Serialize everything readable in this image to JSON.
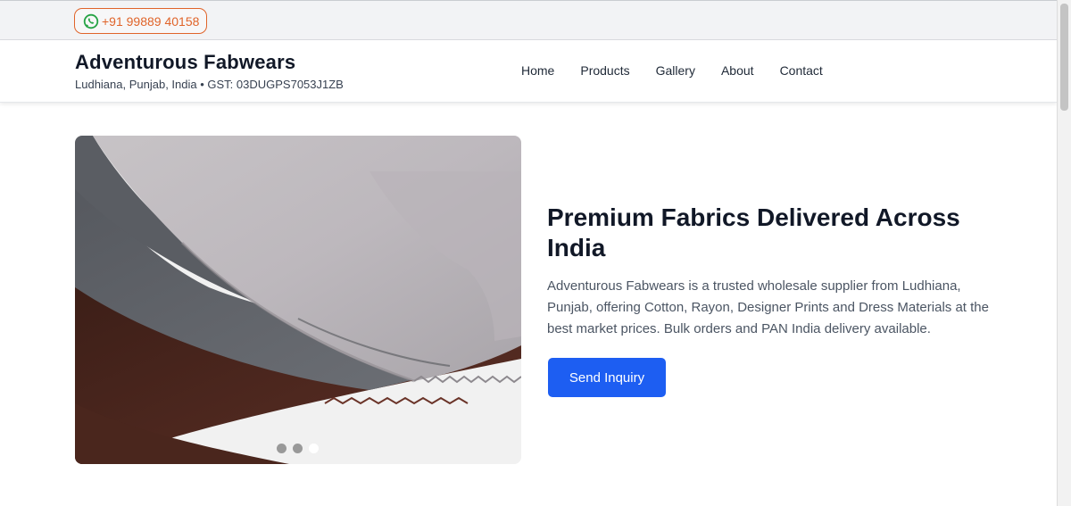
{
  "topbar": {
    "whatsapp_number": "+91 99889 40158",
    "whatsapp_icon": "whatsapp-icon",
    "accent_color": "#e0642a"
  },
  "header": {
    "brand_name": "Adventurous Fabwears",
    "brand_sub": "Ludhiana, Punjab, India • GST: 03DUGPS7053J1ZB",
    "nav": [
      "Home",
      "Products",
      "Gallery",
      "About",
      "Contact"
    ]
  },
  "hero": {
    "title": "Premium Fabrics Delivered Across India",
    "description": "Adventurous Fabwears is a trusted wholesale supplier from Ludhiana, Punjab, offering Cotton, Rayon, Designer Prints and Dress Materials at the best market prices. Bulk orders and PAN India delivery available.",
    "cta_label": "Send Inquiry",
    "cta_color": "#1d5ef2",
    "carousel": {
      "slide_count": 3,
      "active_slide": 3
    }
  }
}
